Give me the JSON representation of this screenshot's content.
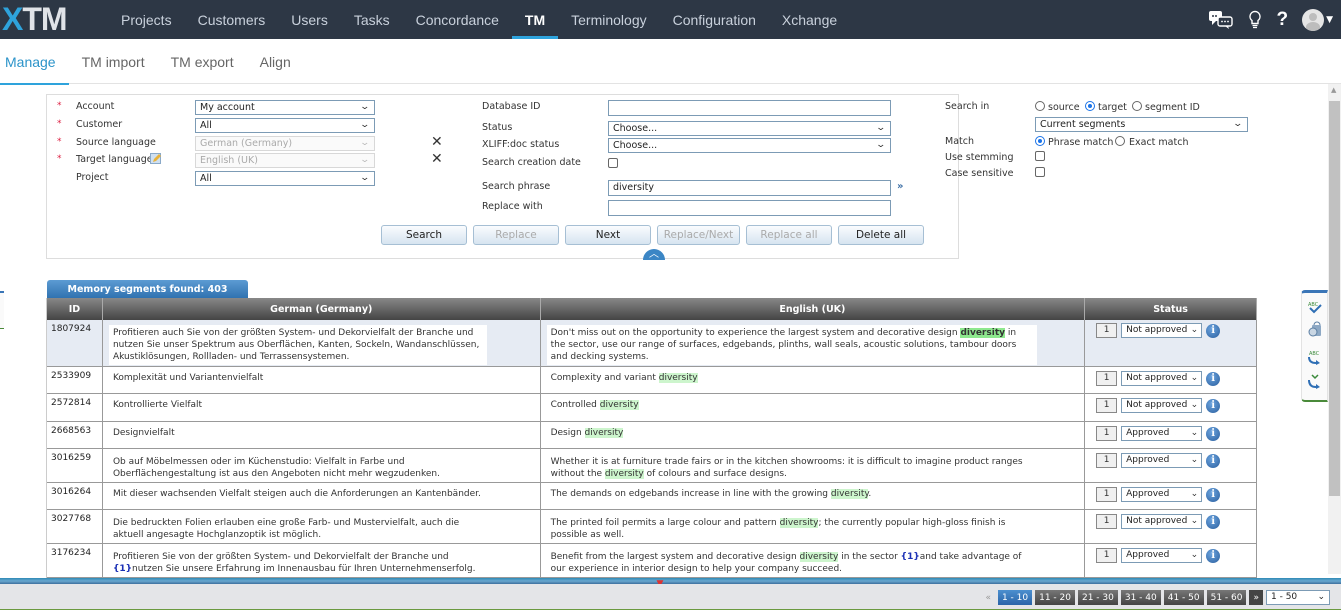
{
  "app": {
    "logo_x": "X",
    "logo_tm": "TM"
  },
  "nav": {
    "items": [
      {
        "label": "Projects",
        "active": false
      },
      {
        "label": "Customers",
        "active": false
      },
      {
        "label": "Users",
        "active": false
      },
      {
        "label": "Tasks",
        "active": false
      },
      {
        "label": "Concordance",
        "active": false
      },
      {
        "label": "TM",
        "active": true
      },
      {
        "label": "Terminology",
        "active": false
      },
      {
        "label": "Configuration",
        "active": false
      },
      {
        "label": "Xchange",
        "active": false
      }
    ],
    "icons": [
      "chat-icon",
      "lightbulb-icon",
      "help-icon",
      "user-avatar"
    ]
  },
  "subtabs": [
    {
      "label": "Manage",
      "active": true
    },
    {
      "label": "TM import",
      "active": false
    },
    {
      "label": "TM export",
      "active": false
    },
    {
      "label": "Align",
      "active": false
    }
  ],
  "search": {
    "account": {
      "label": "Account",
      "value": "My account",
      "required": true
    },
    "customer": {
      "label": "Customer",
      "value": "All",
      "required": true
    },
    "source_language": {
      "label": "Source language",
      "value": "German (Germany)",
      "required": true,
      "disabled": true
    },
    "target_language": {
      "label": "Target language",
      "value": "English (UK)",
      "required": true,
      "disabled": true
    },
    "project": {
      "label": "Project",
      "value": "All"
    },
    "database_id": {
      "label": "Database ID",
      "value": ""
    },
    "status": {
      "label": "Status",
      "value": "Choose..."
    },
    "xliff_status": {
      "label": "XLIFF:doc status",
      "value": "Choose..."
    },
    "search_creation_date": {
      "label": "Search creation date",
      "checked": false
    },
    "search_phrase": {
      "label": "Search phrase",
      "value": "diversity"
    },
    "replace_with": {
      "label": "Replace with",
      "value": ""
    },
    "search_in": {
      "label": "Search in",
      "options": [
        "source",
        "target",
        "segment ID"
      ],
      "selected": "target",
      "scope": "Current segments"
    },
    "match": {
      "label": "Match",
      "options": [
        "Phrase match",
        "Exact match"
      ],
      "selected": "Phrase match"
    },
    "use_stemming": {
      "label": "Use stemming",
      "checked": false
    },
    "case_sensitive": {
      "label": "Case sensitive",
      "checked": false
    },
    "buttons": {
      "search": "Search",
      "replace": "Replace",
      "next": "Next",
      "replace_next": "Replace/Next",
      "replace_all": "Replace all",
      "delete_all": "Delete all"
    }
  },
  "results": {
    "tab_label": "Memory segments found: 403",
    "columns": {
      "id": "ID",
      "source": "German (Germany)",
      "target": "English (UK)",
      "status": "Status"
    },
    "rows": [
      {
        "id": "1807924",
        "source": "Profitieren auch Sie von der größten System- und Dekorvielfalt der Branche und nutzen Sie unser Spektrum aus Oberflächen, Kanten, Sockeln, Wandanschlüssen, Akustiklösungen, Rollladen- und Terrassensystemen.",
        "target_parts": [
          "Don't miss out on the opportunity to experience the largest system and decorative design ",
          "diversity",
          " in the sector, use our range of surfaces, edgebands, plinths, wall seals, acoustic solutions, tambour doors and decking systems."
        ],
        "count": "1",
        "status": "Not approved",
        "selected": true
      },
      {
        "id": "2533909",
        "source": "Komplexität und Variantenvielfalt",
        "target_parts": [
          "Complexity and variant ",
          "diversity",
          ""
        ],
        "count": "1",
        "status": "Not approved"
      },
      {
        "id": "2572814",
        "source": "Kontrollierte Vielfalt",
        "target_parts": [
          "Controlled ",
          "diversity",
          ""
        ],
        "count": "1",
        "status": "Not approved"
      },
      {
        "id": "2668563",
        "source": "Designvielfalt",
        "target_parts": [
          "Design ",
          "diversity",
          ""
        ],
        "count": "1",
        "status": "Approved"
      },
      {
        "id": "3016259",
        "source": "Ob auf Möbelmessen oder im Küchenstudio: Vielfalt in Farbe und Oberflächengestaltung ist aus den Angeboten nicht mehr wegzudenken.",
        "target_parts": [
          "Whether it is at furniture trade fairs or in the kitchen showrooms: it is difficult to imagine  product ranges without the ",
          "diversity",
          " of colours and surface designs."
        ],
        "count": "1",
        "status": "Approved"
      },
      {
        "id": "3016264",
        "source": "Mit dieser wachsenden Vielfalt steigen auch die Anforderungen an Kantenbänder.",
        "target_parts": [
          "The demands on edgebands increase in line with the growing ",
          "diversity",
          "."
        ],
        "count": "1",
        "status": "Approved"
      },
      {
        "id": "3027768",
        "source": "Die bedruckten Folien erlauben eine große Farb- und Mustervielfalt, auch die aktuell angesagte Hochglanzoptik ist möglich.",
        "target_parts": [
          "The printed foil permits a large colour and pattern ",
          "diversity",
          "; the currently popular high-gloss finish is possible as well."
        ],
        "count": "1",
        "status": "Not approved"
      },
      {
        "id": "3176234",
        "source_parts": [
          "Profitieren Sie von der größten System- und Dekorvielfalt der Branche und ",
          "{1}",
          "nutzen Sie unsere Erfahrung im Innenausbau für Ihren Unternehmenserfolg."
        ],
        "target_parts": [
          "Benefit from the largest system and decorative design ",
          "diversity",
          " in the sector ",
          "{1}",
          "and take advantage of our experience in interior design to help your company succeed."
        ],
        "count": "1",
        "status": "Approved"
      }
    ]
  },
  "side_tools": [
    "spellcheck-icon",
    "database-lock-icon",
    "spellcheck-replace-icon",
    "replace-icon"
  ],
  "pager": {
    "prev": "«",
    "next": "»",
    "pages": [
      "1 - 10",
      "11 - 20",
      "21 - 30",
      "31 - 40",
      "41 - 50",
      "51 - 60"
    ],
    "active_page": "1 - 10",
    "per_page": "1 - 50"
  },
  "colors": {
    "nav_bg": "#2d3745",
    "accent": "#2ea3dc",
    "highlight": "#cdf5cd",
    "highlight_strong": "#8ee88e",
    "tag": "#1a2fb5"
  }
}
